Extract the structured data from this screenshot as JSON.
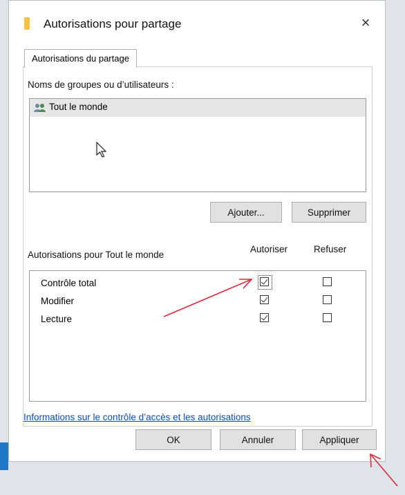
{
  "window": {
    "title": "Autorisations pour partage",
    "close_glyph": "×"
  },
  "tab": {
    "label": "Autorisations du partage"
  },
  "groups": {
    "label": "Noms de groupes ou d’utilisateurs :",
    "items": [
      {
        "label": "Tout le monde",
        "selected": true
      }
    ]
  },
  "group_buttons": {
    "add": "Ajouter...",
    "remove": "Supprimer"
  },
  "permissions": {
    "label": "Autorisations pour Tout le monde",
    "col_allow": "Autoriser",
    "col_deny": "Refuser",
    "rows": [
      {
        "name": "Contrôle total",
        "allow": true,
        "deny": false
      },
      {
        "name": "Modifier",
        "allow": true,
        "deny": false
      },
      {
        "name": "Lecture",
        "allow": true,
        "deny": false
      }
    ]
  },
  "help_link": "Informations sur le contrôle d’accès et les autorisations",
  "footer": {
    "ok": "OK",
    "cancel": "Annuler",
    "apply": "Appliquer"
  },
  "colors": {
    "accent_arrow": "#e0263a",
    "link": "#0a4fb6",
    "selection": "#e6e6e6"
  }
}
